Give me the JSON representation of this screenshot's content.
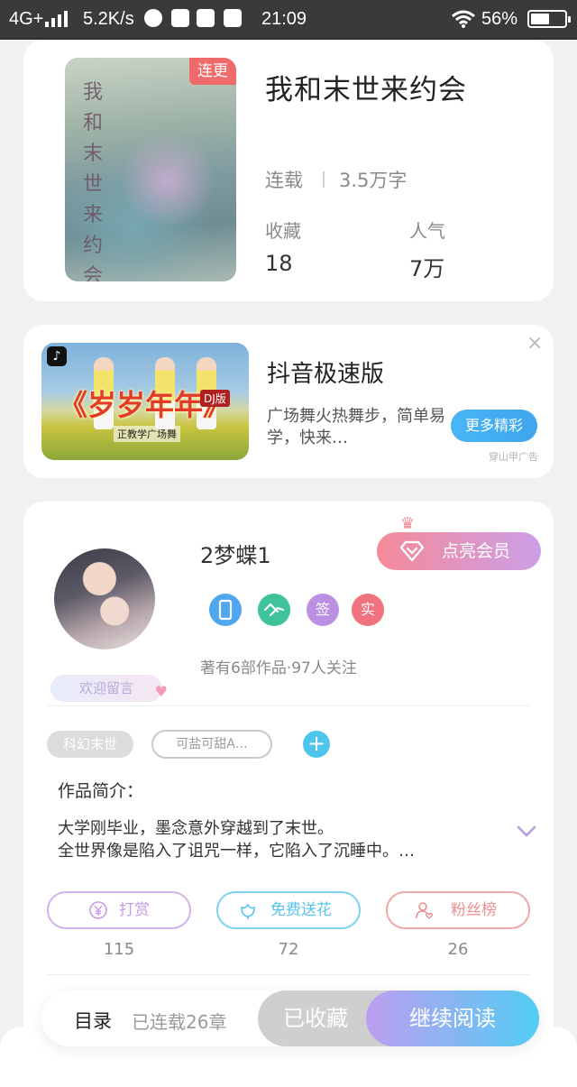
{
  "status_bar": {
    "network": "4G+",
    "speed": "5.2K/s",
    "time": "21:09",
    "battery": "56%",
    "battery_level": 0.56,
    "icons": [
      "signal-icon",
      "app-icon",
      "image-icon",
      "s-icon",
      "message-icon",
      "wifi-icon",
      "battery-icon"
    ]
  },
  "book": {
    "cover_tag": "连更",
    "cover_title_chars": [
      "我",
      "和",
      "末",
      "世",
      "来",
      "约",
      "会"
    ],
    "title": "我和末世来约会",
    "status": "连载",
    "word_count": "3.5万字",
    "favorites_label": "收藏",
    "favorites_value": "18",
    "popularity_label": "人气",
    "popularity_value": "7万"
  },
  "ad": {
    "image_main_text": "《岁岁年年》",
    "image_badge_text": "DJ版",
    "image_footer_text": "正教学广场舞",
    "title": "抖音极速版",
    "description": "广场舞火热舞步，简单易学，快来…",
    "button_label": "更多精彩",
    "close_icon": "×",
    "source_label": "穿山甲广告"
  },
  "author": {
    "welcome_label": "欢迎留言",
    "name": "2梦蝶1",
    "vip_button_label": "点亮会员",
    "badges": [
      {
        "icon": "phone-badge-icon",
        "text": "",
        "color": "#4ea7ef"
      },
      {
        "icon": "handshake-badge-icon",
        "text": "",
        "color": "#3fc39a"
      },
      {
        "icon": "sign-badge-icon",
        "text": "签",
        "color": "#bb8fe3"
      },
      {
        "icon": "verified-badge-icon",
        "text": "实",
        "color": "#f0727e"
      }
    ],
    "stats": "著有6部作品·97人关注"
  },
  "tags": {
    "genre": "科幻末世",
    "custom": "可盐可甜A…",
    "add_label": "+"
  },
  "intro": {
    "label": "作品简介：",
    "line1": "大学刚毕业，墨念意外穿越到了末世。",
    "line2": "全世界像是陷入了诅咒一样，它陷入了沉睡中。…"
  },
  "actions": {
    "reward_label": "打赏",
    "reward_count": "115",
    "flower_label": "免费送花",
    "flower_count": "72",
    "fans_label": "粉丝榜",
    "fans_count": "26"
  },
  "bottom_bar": {
    "toc_label": "目录",
    "chapters_label": "已连载26章",
    "collected_label": "已收藏",
    "continue_label": "继续阅读"
  },
  "colors": {
    "accent_blue": "#4fc5ee",
    "vip_gradient": [
      "#f58a98",
      "#cc9fe8"
    ],
    "continue_gradient": [
      "#bd9ef0",
      "#52cdf4"
    ],
    "reward": "#c79be6",
    "flower": "#56c5ee",
    "fans": "#ee8f8f"
  }
}
